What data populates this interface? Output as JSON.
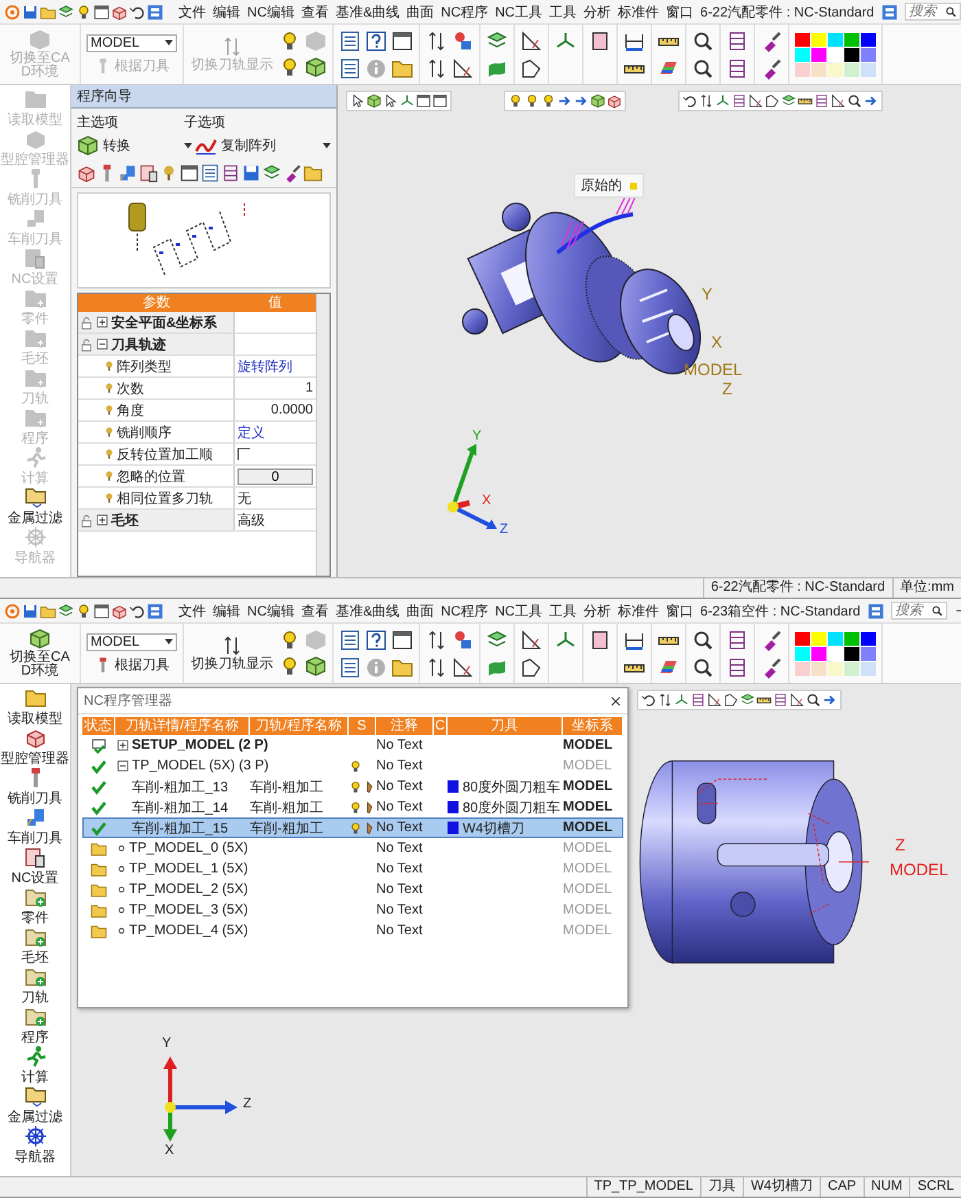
{
  "windows": [
    {
      "title": "6-22汽配零件 : NC-Standard",
      "menu": [
        "文件",
        "编辑",
        "NC编辑",
        "查看",
        "基准&曲线",
        "曲面",
        "NC程序",
        "NC工具",
        "工具",
        "分析",
        "标准件",
        "窗口"
      ],
      "search": {
        "placeholder": "搜索"
      },
      "toolbar": {
        "cad_switch": {
          "label": "切换至CAD环境",
          "disabled": true
        },
        "model_select": {
          "value": "MODEL"
        },
        "by_tool": {
          "label": "根据刀具",
          "disabled": true
        },
        "toggle_display": {
          "label": "切换刀轨显示",
          "disabled": true
        }
      },
      "nav": [
        {
          "label": "读取模型",
          "disabled": true
        },
        {
          "label": "型腔管理器",
          "disabled": true
        },
        {
          "label": "铣削刀具",
          "disabled": true
        },
        {
          "label": "车削刀具",
          "disabled": true
        },
        {
          "label": "NC设置",
          "disabled": true
        },
        {
          "label": "零件",
          "disabled": true
        },
        {
          "label": "毛坯",
          "disabled": true
        },
        {
          "label": "刀轨",
          "disabled": true
        },
        {
          "label": "程序",
          "disabled": true
        },
        {
          "label": "计算",
          "disabled": true
        },
        {
          "label": "金属过滤",
          "disabled": false
        },
        {
          "label": "导航器",
          "disabled": true
        }
      ],
      "wizard": {
        "title": "程序向导",
        "main_option": {
          "label": "主选项",
          "value": "转换"
        },
        "sub_option": {
          "label": "子选项",
          "value": "复制阵列"
        },
        "columns": [
          "参数",
          "值"
        ],
        "rows": [
          {
            "name": "安全平面&坐标系",
            "expanded": false
          },
          {
            "name": "刀具轨迹",
            "expanded": true,
            "children": [
              {
                "name": "阵列类型",
                "kind": "choice",
                "value": "旋转阵列"
              },
              {
                "name": "次数",
                "kind": "number",
                "value": "1"
              },
              {
                "name": "角度",
                "kind": "number",
                "value": "0.0000"
              },
              {
                "name": "铣削顺序",
                "kind": "choice",
                "value": "定义"
              },
              {
                "name": "反转位置加工顺",
                "kind": "checkbox",
                "checked": false
              },
              {
                "name": "忽略的位置",
                "kind": "button",
                "value": "0"
              },
              {
                "name": "相同位置多刀轨",
                "kind": "text",
                "value": "无"
              }
            ]
          },
          {
            "name": "毛坯",
            "expanded": false,
            "value": "高级"
          }
        ]
      },
      "viewport": {
        "callout": "原始的",
        "part_axes": {
          "y": "Y",
          "x": "X",
          "name": "MODEL",
          "z": "Z"
        },
        "triad": {
          "y": "Y",
          "x": "X",
          "z": "Z"
        }
      },
      "status_bar": [
        "6-22汽配零件 : NC-Standard",
        "单位:mm"
      ]
    },
    {
      "title": "6-23箱空件 : NC-Standard",
      "menu": [
        "文件",
        "编辑",
        "NC编辑",
        "查看",
        "基准&曲线",
        "曲面",
        "NC程序",
        "NC工具",
        "工具",
        "分析",
        "标准件",
        "窗口"
      ],
      "search": {
        "placeholder": "搜索"
      },
      "toolbar": {
        "cad_switch": {
          "label": "切换至CAD环境",
          "disabled": false
        },
        "model_select": {
          "value": "MODEL"
        },
        "by_tool": {
          "label": "根据刀具",
          "disabled": false
        },
        "toggle_display": {
          "label": "切换刀轨显示",
          "disabled": false
        }
      },
      "nav": [
        {
          "label": "读取模型",
          "disabled": false
        },
        {
          "label": "型腔管理器",
          "disabled": false
        },
        {
          "label": "铣削刀具",
          "disabled": false
        },
        {
          "label": "车削刀具",
          "disabled": false
        },
        {
          "label": "NC设置",
          "disabled": false
        },
        {
          "label": "零件",
          "disabled": false
        },
        {
          "label": "毛坯",
          "disabled": false
        },
        {
          "label": "刀轨",
          "disabled": false
        },
        {
          "label": "程序",
          "disabled": false
        },
        {
          "label": "计算",
          "disabled": false
        },
        {
          "label": "金属过滤",
          "disabled": false
        },
        {
          "label": "导航器",
          "disabled": false
        }
      ],
      "nc_manager": {
        "title": "NC程序管理器",
        "columns": [
          "状态",
          "刀轨详情/程序名称",
          "刀轨/程序名称",
          "S",
          "注释",
          "C",
          "刀具",
          "坐标系"
        ],
        "rows": [
          {
            "kind": "setup",
            "done": true,
            "name": "SETUP_MODEL (2 P)",
            "expanded": false,
            "comment": "No Text",
            "csys": "MODEL",
            "selected": false
          },
          {
            "kind": "folder",
            "done": true,
            "name": "TP_MODEL (5X) (3 P)",
            "expanded": true,
            "comment": "No Text",
            "csys": "MODEL",
            "selected": false,
            "children": [
              {
                "kind": "procedure",
                "done": true,
                "name": "车削-粗加工_13",
                "program": "车削-粗加工",
                "comment": "No Text",
                "tool": "80度外圆刀粗车",
                "color": "#1010e0",
                "csys": "MODEL",
                "selected": false
              },
              {
                "kind": "procedure",
                "done": true,
                "name": "车削-粗加工_14",
                "program": "车削-粗加工",
                "comment": "No Text",
                "tool": "80度外圆刀粗车",
                "color": "#1010e0",
                "csys": "MODEL",
                "selected": false
              },
              {
                "kind": "procedure",
                "done": true,
                "name": "车削-粗加工_15",
                "program": "车削-粗加工",
                "comment": "No Text",
                "tool": "W4切槽刀",
                "color": "#1010e0",
                "csys": "MODEL",
                "selected": true
              }
            ]
          },
          {
            "kind": "folder",
            "done": false,
            "name": "TP_MODEL_0 (5X)",
            "comment": "No Text",
            "csys": "MODEL",
            "selected": false
          },
          {
            "kind": "folder",
            "done": false,
            "name": "TP_MODEL_1 (5X)",
            "comment": "No Text",
            "csys": "MODEL",
            "selected": false
          },
          {
            "kind": "folder",
            "done": false,
            "name": "TP_MODEL_2 (5X)",
            "comment": "No Text",
            "csys": "MODEL",
            "selected": false
          },
          {
            "kind": "folder",
            "done": false,
            "name": "TP_MODEL_3 (5X)",
            "comment": "No Text",
            "csys": "MODEL",
            "selected": false
          },
          {
            "kind": "folder",
            "done": false,
            "name": "TP_MODEL_4 (5X)",
            "comment": "No Text",
            "csys": "MODEL",
            "selected": false
          }
        ]
      },
      "viewport": {
        "part_axes": {
          "z": "Z",
          "name": "MODEL"
        },
        "triad": {
          "y": "Y",
          "z": "Z",
          "x": "X"
        }
      },
      "status_bar": [
        "TP_TP_MODEL",
        "刀具",
        "W4切槽刀",
        "CAP",
        "NUM",
        "SCRL"
      ]
    }
  ]
}
